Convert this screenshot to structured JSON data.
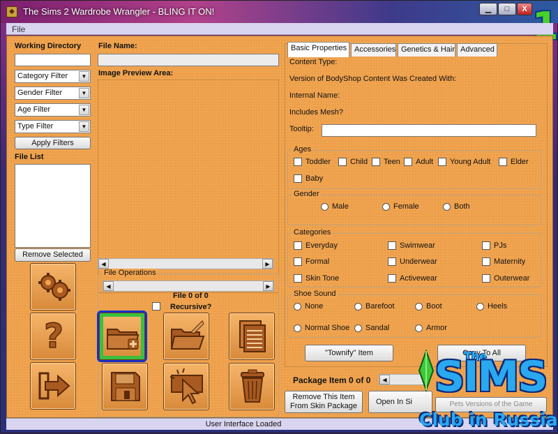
{
  "window": {
    "title": "The Sims 2 Wardrobe Wrangler - BLING IT ON!",
    "minimize": "▁",
    "maximize": "□",
    "close": "X",
    "corner_badge": "1"
  },
  "menu": {
    "file": "File"
  },
  "left": {
    "working_directory_label": "Working Directory",
    "filters": [
      "Category Filter",
      "Gender Filter",
      "Age Filter",
      "Type Filter"
    ],
    "apply_filters": "Apply Filters",
    "file_list_label": "File List",
    "remove_selected": "Remove Selected"
  },
  "center": {
    "file_name_label": "File Name:",
    "preview_label": "Image Preview Area:",
    "file_operations_label": "File Operations",
    "file_count": "File 0 of 0",
    "recursive_label": "Recursive?",
    "package_item": "Package Item 0 of 0",
    "remove_item": "Remove This Item From Skin Package",
    "open_in": "Open In Si"
  },
  "tabs": [
    "Basic Properties",
    "Accessories",
    "Genetics & Hair",
    "Advanced"
  ],
  "props": {
    "content_type": "Content Type:",
    "version": "Version of BodyShop Content Was Created With:",
    "internal_name": "Internal Name:",
    "includes_mesh": "Includes Mesh?",
    "tooltip": "Tooltip:"
  },
  "ages": {
    "label": "Ages",
    "items": [
      "Toddler",
      "Child",
      "Teen",
      "Adult",
      "Young Adult",
      "Elder",
      "Baby"
    ]
  },
  "gender": {
    "label": "Gender",
    "items": [
      "Male",
      "Female",
      "Both"
    ]
  },
  "categories": {
    "label": "Categories",
    "items": [
      "Everyday",
      "Swimwear",
      "PJs",
      "Formal",
      "Underwear",
      "Maternity",
      "Skin Tone",
      "Activewear",
      "Outerwear"
    ]
  },
  "shoe": {
    "label": "Shoe Sound",
    "items": [
      "None",
      "Barefoot",
      "Boot",
      "Heels",
      "Normal Shoe",
      "Sandal",
      "Armor"
    ]
  },
  "actions": {
    "townify": "\"Townify\" Item",
    "copy_to_all": "Copy To All",
    "pets_versions": "Pets Versions of the Game"
  },
  "status": "User Interface Loaded",
  "logo": {
    "the": "The",
    "sims": "SIMS",
    "club": "Club in Russia"
  },
  "colors": {
    "panel_orange": "#f0a450",
    "selected_outline": "#1a2ec8",
    "selected_glow": "#3cc03c"
  }
}
